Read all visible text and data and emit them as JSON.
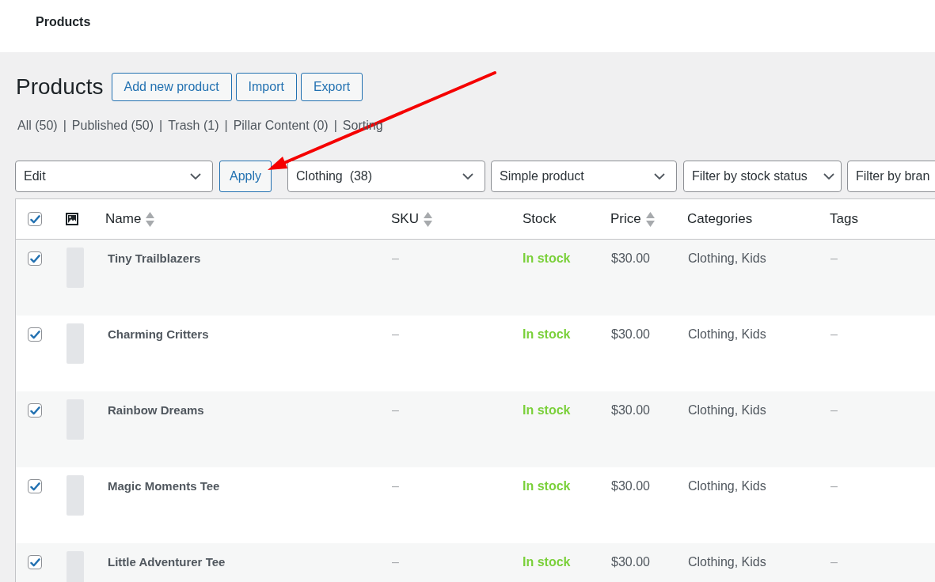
{
  "top_bar": {
    "title": "Products"
  },
  "page": {
    "heading": "Products",
    "actions": [
      "Add new product",
      "Import",
      "Export"
    ]
  },
  "views": {
    "separator": "|",
    "items": [
      "All (50)",
      "Published (50)",
      "Trash (1)",
      "Pillar Content (0)",
      "Sorting"
    ]
  },
  "bulk_action": {
    "value": "Edit",
    "button": "Apply"
  },
  "filters": [
    {
      "value": "Clothing  (38)"
    },
    {
      "value": "Simple product"
    },
    {
      "value": "Filter by stock status"
    },
    {
      "value": "Filter by bran"
    }
  ],
  "table": {
    "select_all": {
      "checked": true
    },
    "columns": [
      {
        "kind": "image"
      },
      {
        "kind": "text",
        "label": "Name",
        "sortable": true
      },
      {
        "kind": "text",
        "label": "SKU",
        "sortable": true
      },
      {
        "kind": "text",
        "label": "Stock",
        "sortable": false
      },
      {
        "kind": "text",
        "label": "Price",
        "sortable": true
      },
      {
        "kind": "text",
        "label": "Categories",
        "sortable": false
      },
      {
        "kind": "text",
        "label": "Tags",
        "sortable": false
      }
    ],
    "rows": [
      {
        "checked": true,
        "name": "Tiny Trailblazers",
        "sku": "–",
        "stock": "In stock",
        "price": "$30.00",
        "categories": "Clothing, Kids",
        "tags": "–"
      },
      {
        "checked": true,
        "name": "Charming Critters",
        "sku": "–",
        "stock": "In stock",
        "price": "$30.00",
        "categories": "Clothing, Kids",
        "tags": "–"
      },
      {
        "checked": true,
        "name": "Rainbow Dreams",
        "sku": "–",
        "stock": "In stock",
        "price": "$30.00",
        "categories": "Clothing, Kids",
        "tags": "–"
      },
      {
        "checked": true,
        "name": "Magic Moments Tee",
        "sku": "–",
        "stock": "In stock",
        "price": "$30.00",
        "categories": "Clothing, Kids",
        "tags": "–"
      },
      {
        "checked": true,
        "name": "Little Adventurer Tee",
        "sku": "–",
        "stock": "In stock",
        "price": "$30.00",
        "categories": "Clothing, Kids",
        "tags": "–"
      }
    ]
  },
  "annotations": [
    {
      "kind": "arrow"
    }
  ]
}
